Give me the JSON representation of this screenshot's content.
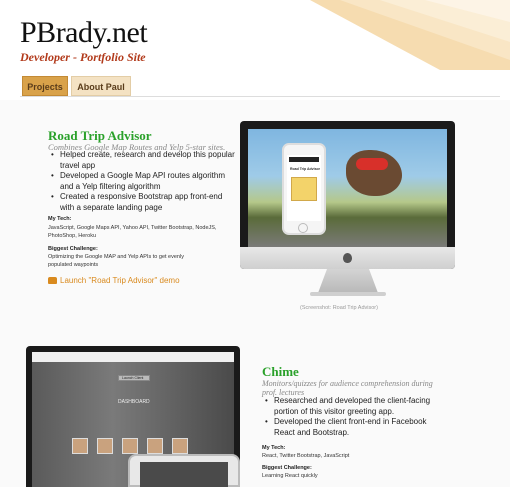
{
  "header": {
    "title": "PBrady.net",
    "subtitle": "Developer - Portfolio Site"
  },
  "nav": {
    "tabs": [
      {
        "label": "Projects",
        "active": true
      },
      {
        "label": "About Paul",
        "active": false
      }
    ]
  },
  "projects": [
    {
      "title": "Road Trip Advisor",
      "subtitle": "Combines Google Map Routes and Yelp 5-star sites.",
      "bullets": [
        "Helped create, research and develop this popular travel app",
        "Developed a Google Map API routes algorithm and a Yelp filtering algorithm",
        "Created a responsive Bootstrap app front-end with a separate landing page"
      ],
      "tech_heading": "My Tech:",
      "tech": "JavaScript, Google Maps API, Yahoo API, Twitter Bootstrap, NodeJS, PhotoShop, Heroku",
      "challenge_heading": "Biggest Challenge:",
      "challenge": "Optimizing the Google MAP and Yelp APIs to get evenly populated waypoints",
      "demo_link": "Launch \"Road Trip Advisor\" demo",
      "screenshot_caption": "(Screenshot: Road Trip Advisor)",
      "phone_title": "Road Trip Advisor"
    },
    {
      "title": "Chime",
      "subtitle": "Monitors/quizzes for audience comprehension during prof. lectures",
      "bullets": [
        "Researched and developed the client-facing portion of this visitor greeting app.",
        "Developed the client front-end in Facebook React and Bootstrap."
      ],
      "tech_heading": "My Tech:",
      "tech": "React, Twitter Bootstrap, JavaScript",
      "challenge_heading": "Biggest Challenge:",
      "challenge": "Learning React quickly",
      "screen_button": "Launch Client",
      "screen_heading": "DASHBOARD"
    }
  ],
  "colors": {
    "project_title": "#2aa12a",
    "subtitle": "#b23a1b",
    "tab_active": "#d9a24a",
    "tab_inactive": "#f4e2c3",
    "link": "#d98a1e"
  }
}
